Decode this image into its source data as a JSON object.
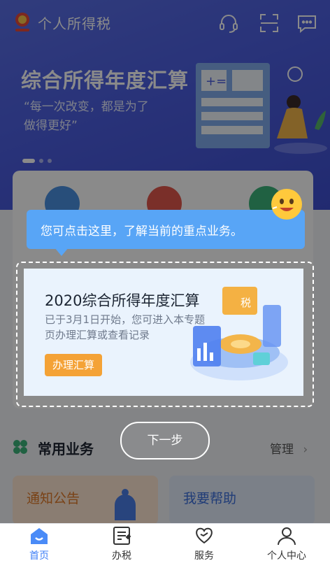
{
  "header": {
    "app_title": "个人所得税",
    "icons": [
      "customer-service-icon",
      "scan-icon",
      "message-icon"
    ]
  },
  "banner": {
    "title": "综合所得年度汇算",
    "subtitle": "“每一次改变，都是为了做得更好”",
    "active_slide": 1,
    "slide_count": 3
  },
  "guide": {
    "tip_text": "您可点击这里，了解当前的重点业务。",
    "next_label": "下一步"
  },
  "feature": {
    "title": "2020综合所得年度汇算",
    "description": "已于3月1日开始，您可进入本专题页办理汇算或查看记录",
    "button_label": "办理汇算",
    "illu_tax_label": "税"
  },
  "common": {
    "title": "常用业务",
    "manage_label": "管理",
    "tiles": [
      {
        "label": "通知公告"
      },
      {
        "label": "我要帮助"
      }
    ]
  },
  "tabbar": {
    "items": [
      {
        "label": "首页",
        "icon": "home-icon",
        "active": true
      },
      {
        "label": "办税",
        "icon": "tax-form-icon",
        "active": false
      },
      {
        "label": "服务",
        "icon": "heart-service-icon",
        "active": false
      },
      {
        "label": "个人中心",
        "icon": "user-icon",
        "active": false
      }
    ]
  },
  "colors": {
    "brand_blue": "#4c5ee0",
    "tip_blue": "#58a5f6",
    "button_orange": "#f4a236",
    "tab_active": "#3e7ff7"
  }
}
